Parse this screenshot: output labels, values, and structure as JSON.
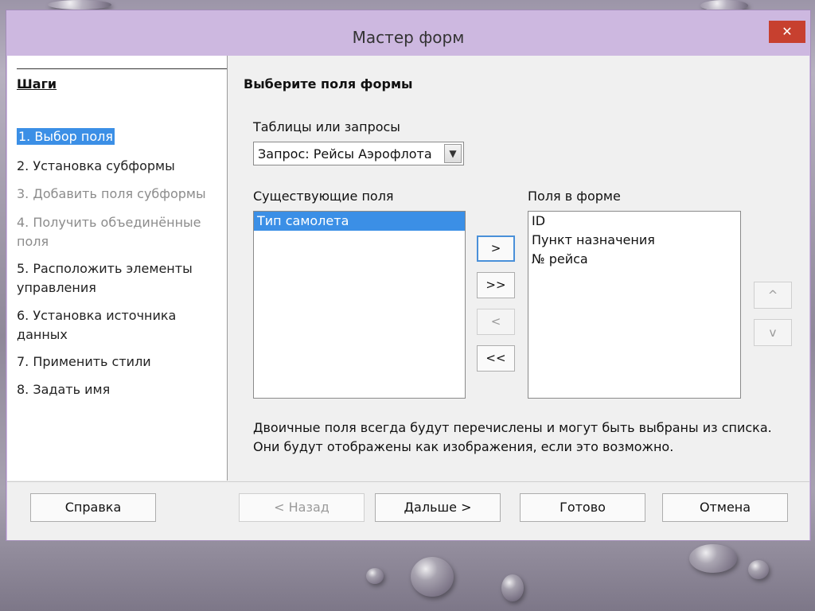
{
  "window": {
    "title": "Мастер форм",
    "close_label": "✕"
  },
  "steps": {
    "title": "Шаги",
    "items": [
      {
        "label": "1. Выбор поля",
        "state": "active"
      },
      {
        "label": "2. Установка субформы",
        "state": "enabled"
      },
      {
        "label": "3. Добавить поля субформы",
        "state": "disabled"
      },
      {
        "label": "4. Получить объединённые поля",
        "state": "disabled"
      },
      {
        "label": "5. Расположить элементы управления",
        "state": "enabled"
      },
      {
        "label": "6. Установка источника данных",
        "state": "enabled"
      },
      {
        "label": "7. Применить стили",
        "state": "enabled"
      },
      {
        "label": "8. Задать имя",
        "state": "enabled"
      }
    ]
  },
  "main": {
    "section_title": "Выберите поля формы",
    "tables_label": "Таблицы или запросы",
    "tables_value": "Запрос: Рейсы Аэрофлота",
    "existing_label": "Существующие поля",
    "existing_fields": [
      "Тип самолета"
    ],
    "form_label": "Поля в форме",
    "form_fields": [
      "ID",
      "Пункт назначения",
      "№ рейса"
    ],
    "move_buttons": {
      "add_one": ">",
      "add_all": ">>",
      "remove_one": "<",
      "remove_all": "<<"
    },
    "order_buttons": {
      "up": "^",
      "down": "v"
    },
    "info_line1": "Двоичные поля всегда будут перечислены и могут быть выбраны из списка.",
    "info_line2": "Они будут отображены как изображения, если это возможно."
  },
  "footer": {
    "help": "Справка",
    "back": "< Назад",
    "next": "Дальше >",
    "finish": "Готово",
    "cancel": "Отмена"
  },
  "colors": {
    "titlebar": "#cdb8e0",
    "close": "#c7402f",
    "selection": "#3b8fe6"
  }
}
